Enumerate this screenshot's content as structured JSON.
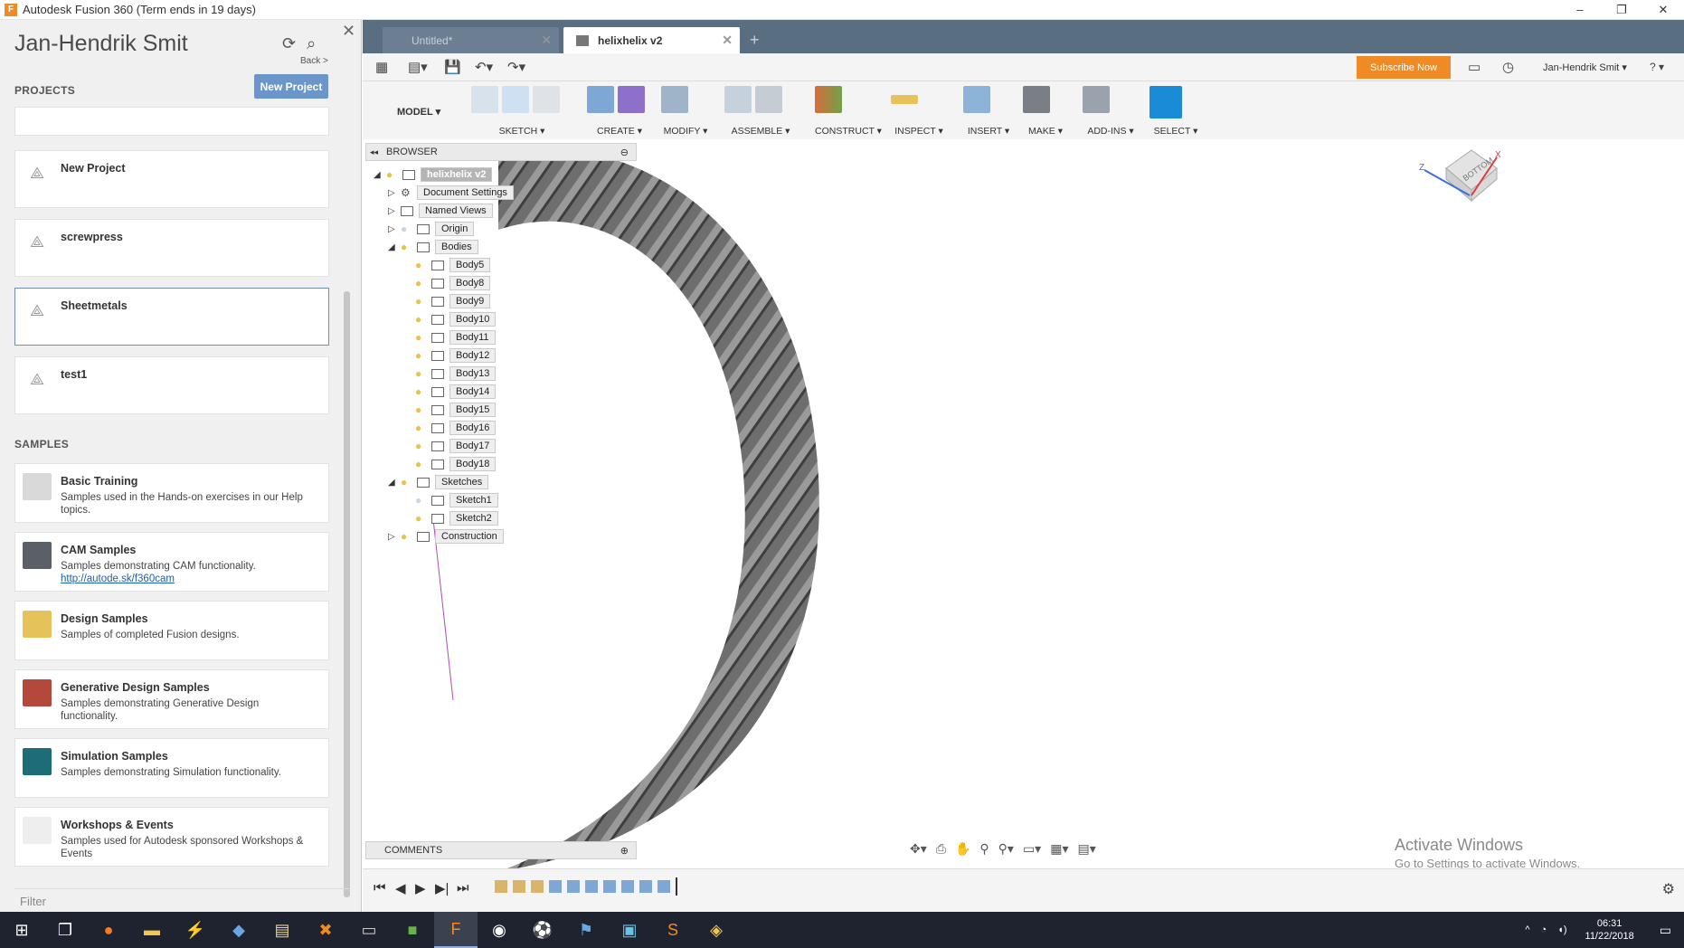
{
  "window": {
    "title": "Autodesk Fusion 360 (Term ends in 19 days)",
    "app_icon": "F"
  },
  "left_panel": {
    "user_name": "Jan-Hendrik Smit",
    "back_label": "Back >",
    "projects_title": "PROJECTS",
    "new_project_label": "New Project",
    "projects": [
      {
        "name": "New Project"
      },
      {
        "name": "screwpress"
      },
      {
        "name": "Sheetmetals"
      },
      {
        "name": "test1"
      }
    ],
    "samples_title": "SAMPLES",
    "samples": [
      {
        "title": "Basic Training",
        "desc": "Samples used in the Hands-on exercises in our Help topics.",
        "link": ""
      },
      {
        "title": "CAM Samples",
        "desc": "Samples demonstrating CAM functionality.",
        "link": "http://autode.sk/f360cam"
      },
      {
        "title": "Design Samples",
        "desc": "Samples of completed Fusion designs.",
        "link": ""
      },
      {
        "title": "Generative Design Samples",
        "desc": "Samples demonstrating Generative Design functionality.",
        "link": ""
      },
      {
        "title": "Simulation Samples",
        "desc": "Samples demonstrating Simulation functionality.",
        "link": ""
      },
      {
        "title": "Workshops & Events",
        "desc": "Samples used for Autodesk sponsored Workshops & Events",
        "link": ""
      }
    ],
    "filter_placeholder": "Filter"
  },
  "tabs": [
    {
      "label": "Untitled*",
      "active": false
    },
    {
      "label": "helixhelix v2",
      "active": true
    }
  ],
  "quick_access": {
    "subscribe_label": "Subscribe Now",
    "user_label": "Jan-Hendrik Smit ▾",
    "help_label": "? ▾"
  },
  "toolbar": {
    "workspace": "MODEL ▾",
    "groups": [
      "SKETCH ▾",
      "CREATE ▾",
      "MODIFY ▾",
      "ASSEMBLE ▾",
      "CONSTRUCT ▾",
      "INSPECT ▾",
      "INSERT ▾",
      "MAKE ▾",
      "ADD-INS ▾",
      "SELECT ▾"
    ]
  },
  "browser": {
    "title": "BROWSER",
    "root": "helixhelix v2",
    "items": [
      {
        "label": "Document Settings",
        "level": 1
      },
      {
        "label": "Named Views",
        "level": 1
      },
      {
        "label": "Origin",
        "level": 1
      },
      {
        "label": "Bodies",
        "level": 1
      },
      {
        "label": "Body5",
        "level": 2
      },
      {
        "label": "Body8",
        "level": 2
      },
      {
        "label": "Body9",
        "level": 2
      },
      {
        "label": "Body10",
        "level": 2
      },
      {
        "label": "Body11",
        "level": 2
      },
      {
        "label": "Body12",
        "level": 2
      },
      {
        "label": "Body13",
        "level": 2
      },
      {
        "label": "Body14",
        "level": 2
      },
      {
        "label": "Body15",
        "level": 2
      },
      {
        "label": "Body16",
        "level": 2
      },
      {
        "label": "Body17",
        "level": 2
      },
      {
        "label": "Body18",
        "level": 2
      },
      {
        "label": "Sketches",
        "level": 1
      },
      {
        "label": "Sketch1",
        "level": 2
      },
      {
        "label": "Sketch2",
        "level": 2
      },
      {
        "label": "Construction",
        "level": 1
      }
    ]
  },
  "comments_label": "COMMENTS",
  "viewcube_label": "BOTTOM",
  "viewcube_axes": {
    "x": "X",
    "z": "Z"
  },
  "watermark": {
    "line1": "Activate Windows",
    "line2": "Go to Settings to activate Windows."
  },
  "taskbar": {
    "time": "06:31",
    "date": "11/22/2018"
  },
  "colors": {
    "accent": "#f08a24",
    "tab_bar": "#5a6e82",
    "select_blue": "#1a8bd6"
  }
}
